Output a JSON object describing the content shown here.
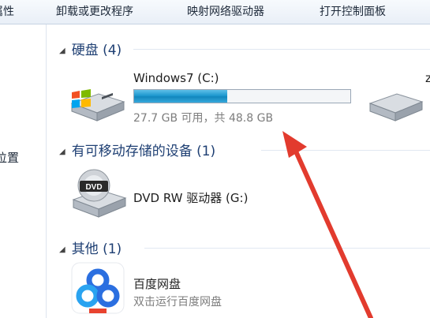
{
  "toolbar": {
    "items": [
      {
        "label": "属性"
      },
      {
        "label": "卸载或更改程序"
      },
      {
        "label": "映射网络驱动器"
      },
      {
        "label": "打开控制面板"
      }
    ]
  },
  "nav": {
    "partial_item": "位置"
  },
  "groups": {
    "hard_disks": {
      "header": "硬盘 (4)",
      "drive_c": {
        "name": "Windows7 (C:)",
        "space_text": "27.7 GB 可用，共 48.8 GB",
        "used_fraction": 0.43,
        "bar_color": "#1e98cf"
      },
      "next_drive_partial_name": "z"
    },
    "removable": {
      "header": "有可移动存储的设备 (1)",
      "dvd": {
        "name": "DVD RW 驱动器 (G:)",
        "icon_text": "DVD"
      }
    },
    "other": {
      "header": "其他 (1)",
      "baidu": {
        "name": "百度网盘",
        "subtitle": "双击运行百度网盘"
      }
    }
  },
  "annotation": {
    "arrow_color": "#e23b2e"
  }
}
